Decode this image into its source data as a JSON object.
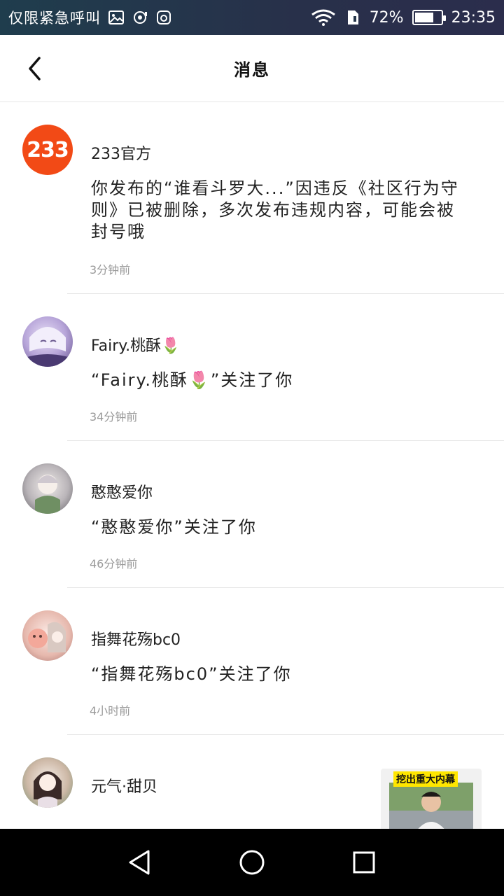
{
  "status_bar": {
    "carrier": "仅限紧急呼叫",
    "battery_text": "72%",
    "battery_level": 0.72,
    "time": "23:35",
    "icons": [
      "gallery-icon",
      "sync-icon",
      "app-icon",
      "wifi-icon",
      "sim-icon",
      "battery-icon"
    ]
  },
  "header": {
    "title": "消息",
    "back_icon": "chevron-left-icon"
  },
  "messages": [
    {
      "avatar_text": "233",
      "name": "233官方",
      "text": "你发布的“谁看斗罗大...”因违反《社区行为守则》已被删除，多次发布违规内容，可能会被封号哦",
      "time": "3分钟前"
    },
    {
      "name": "Fairy.桃酥🌷",
      "text": "“Fairy.桃酥🌷”关注了你",
      "time": "34分钟前"
    },
    {
      "name": "憨憨爱你",
      "text": "“憨憨爱你”关注了你",
      "time": "46分钟前"
    },
    {
      "name": "指舞花殇bc0",
      "text": "“指舞花殇bc0”关注了你",
      "time": "4小时前"
    },
    {
      "name": "元气·甜贝"
    }
  ],
  "ad": {
    "label": "挖出重大内幕"
  },
  "nav_bar": {
    "icons": [
      "back-triangle-icon",
      "home-circle-icon",
      "recents-square-icon"
    ]
  },
  "colors": {
    "status_bar_bg": "#26364a",
    "brand_233": "#f24a16",
    "time_text": "#999999",
    "ad_label": "#ffe600"
  }
}
